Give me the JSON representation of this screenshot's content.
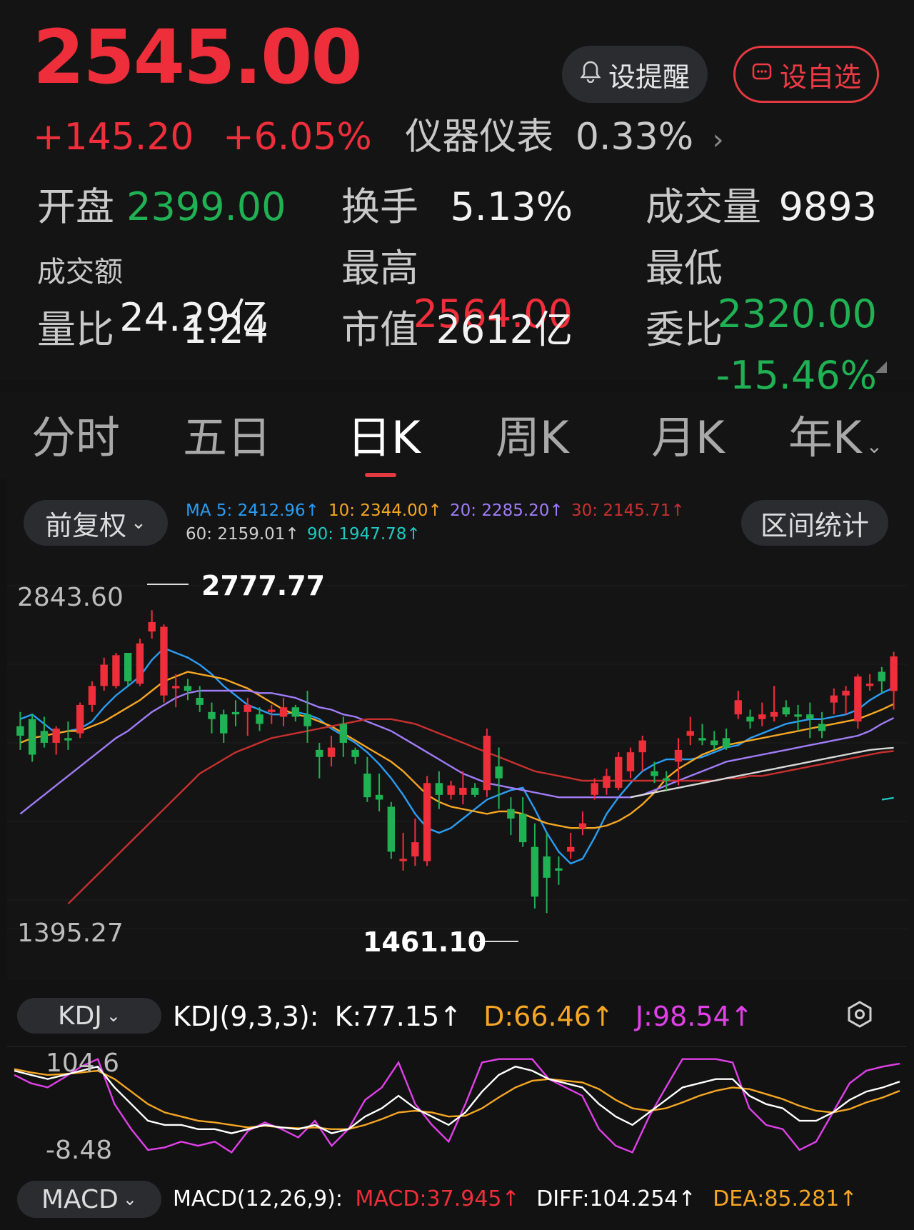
{
  "quote": {
    "price": "2545.00",
    "change": "+145.20",
    "change_pct": "+6.05%",
    "sector_name": "仪器仪表",
    "sector_pct": "0.33%"
  },
  "actions": {
    "alert_label": "设提醒",
    "watchlist_label": "设自选"
  },
  "stats": [
    {
      "label": "开盘",
      "value": "2399.00",
      "color": "green"
    },
    {
      "label": "换手",
      "value": "5.13%",
      "color": "white"
    },
    {
      "label": "成交量",
      "value": "9893",
      "color": "white"
    },
    {
      "label": "成交额",
      "value": "24.29亿",
      "color": "white"
    },
    {
      "label": "最高",
      "value": "2564.00",
      "color": "red"
    },
    {
      "label": "最低",
      "value": "2320.00",
      "color": "green"
    },
    {
      "label": "量比",
      "value": "1.24",
      "color": "white"
    },
    {
      "label": "市值",
      "value": "2612亿",
      "color": "white"
    },
    {
      "label": "委比",
      "value": "-15.46%",
      "color": "green"
    }
  ],
  "tabs": [
    {
      "label": "分时",
      "active": false
    },
    {
      "label": "五日",
      "active": false
    },
    {
      "label": "日K",
      "active": true
    },
    {
      "label": "周K",
      "active": false
    },
    {
      "label": "月K",
      "active": false
    },
    {
      "label": "年K",
      "active": false
    }
  ],
  "chart_controls": {
    "adjust_label": "前复权",
    "range_label": "区间统计"
  },
  "ma_legend": [
    {
      "text": "MA 5: 2412.96↑",
      "color": "#2a9df4"
    },
    {
      "text": "10: 2344.00↑",
      "color": "#f5a623"
    },
    {
      "text": "20: 2285.20↑",
      "color": "#a07cf7"
    },
    {
      "text": "30: 2145.71↑",
      "color": "#c8302f"
    },
    {
      "text": "60: 2159.01↑",
      "color": "#cfcfcf"
    },
    {
      "text": "90: 1947.78↑",
      "color": "#1fc9c0"
    }
  ],
  "colors": {
    "up": "#ee2e3a",
    "down": "#1fb153",
    "ma5": "#2a9df4",
    "ma10": "#f5a623",
    "ma20": "#a07cf7",
    "ma30": "#c8302f",
    "ma60": "#d8d8d8",
    "ma90": "#1fc9c0"
  },
  "chart_data": {
    "type": "candlestick",
    "y_axis_top_label": "2843.60",
    "y_axis_bottom_label": "1395.27",
    "ylim": [
      1395.27,
      2843.6
    ],
    "high_marker": "2777.77",
    "low_marker": "1461.10",
    "candles": [
      {
        "o": 2250,
        "h": 2310,
        "l": 2150,
        "c": 2210
      },
      {
        "o": 2280,
        "h": 2300,
        "l": 2100,
        "c": 2130
      },
      {
        "o": 2230,
        "h": 2290,
        "l": 2160,
        "c": 2180
      },
      {
        "o": 2180,
        "h": 2250,
        "l": 2130,
        "c": 2240
      },
      {
        "o": 2200,
        "h": 2270,
        "l": 2150,
        "c": 2190
      },
      {
        "o": 2220,
        "h": 2350,
        "l": 2200,
        "c": 2340
      },
      {
        "o": 2340,
        "h": 2440,
        "l": 2310,
        "c": 2420
      },
      {
        "o": 2420,
        "h": 2540,
        "l": 2400,
        "c": 2510
      },
      {
        "o": 2420,
        "h": 2560,
        "l": 2410,
        "c": 2550
      },
      {
        "o": 2560,
        "h": 2520,
        "l": 2420,
        "c": 2440
      },
      {
        "o": 2430,
        "h": 2620,
        "l": 2420,
        "c": 2600
      },
      {
        "o": 2650,
        "h": 2740,
        "l": 2620,
        "c": 2690
      },
      {
        "o": 2380,
        "h": 2680,
        "l": 2350,
        "c": 2670
      },
      {
        "o": 2410,
        "h": 2470,
        "l": 2330,
        "c": 2420
      },
      {
        "o": 2420,
        "h": 2450,
        "l": 2360,
        "c": 2400
      },
      {
        "o": 2370,
        "h": 2420,
        "l": 2310,
        "c": 2340
      },
      {
        "o": 2310,
        "h": 2350,
        "l": 2220,
        "c": 2280
      },
      {
        "o": 2300,
        "h": 2320,
        "l": 2180,
        "c": 2220
      },
      {
        "o": 2310,
        "h": 2360,
        "l": 2250,
        "c": 2300
      },
      {
        "o": 2310,
        "h": 2370,
        "l": 2210,
        "c": 2340
      },
      {
        "o": 2300,
        "h": 2330,
        "l": 2230,
        "c": 2260
      },
      {
        "o": 2310,
        "h": 2340,
        "l": 2260,
        "c": 2320
      },
      {
        "o": 2290,
        "h": 2370,
        "l": 2250,
        "c": 2330
      },
      {
        "o": 2330,
        "h": 2340,
        "l": 2270,
        "c": 2290
      },
      {
        "o": 2300,
        "h": 2400,
        "l": 2180,
        "c": 2250
      },
      {
        "o": 2150,
        "h": 2180,
        "l": 2030,
        "c": 2120
      },
      {
        "o": 2120,
        "h": 2210,
        "l": 2080,
        "c": 2160
      },
      {
        "o": 2260,
        "h": 2290,
        "l": 2120,
        "c": 2180
      },
      {
        "o": 2150,
        "h": 2160,
        "l": 2090,
        "c": 2120
      },
      {
        "o": 2050,
        "h": 2120,
        "l": 1930,
        "c": 1950
      },
      {
        "o": 1960,
        "h": 2050,
        "l": 1890,
        "c": 1940
      },
      {
        "o": 1910,
        "h": 1930,
        "l": 1690,
        "c": 1720
      },
      {
        "o": 1680,
        "h": 1800,
        "l": 1640,
        "c": 1690
      },
      {
        "o": 1700,
        "h": 1860,
        "l": 1660,
        "c": 1760
      },
      {
        "o": 1680,
        "h": 2040,
        "l": 1660,
        "c": 2010
      },
      {
        "o": 2010,
        "h": 2060,
        "l": 1900,
        "c": 1960
      },
      {
        "o": 1960,
        "h": 2020,
        "l": 1940,
        "c": 2000
      },
      {
        "o": 1960,
        "h": 2060,
        "l": 1920,
        "c": 1990
      },
      {
        "o": 1990,
        "h": 2010,
        "l": 1950,
        "c": 1960
      },
      {
        "o": 1980,
        "h": 2240,
        "l": 1950,
        "c": 2210
      },
      {
        "o": 2080,
        "h": 2160,
        "l": 1900,
        "c": 2030
      },
      {
        "o": 1900,
        "h": 1950,
        "l": 1790,
        "c": 1860
      },
      {
        "o": 1880,
        "h": 1950,
        "l": 1740,
        "c": 1760
      },
      {
        "o": 1740,
        "h": 1840,
        "l": 1480,
        "c": 1530
      },
      {
        "o": 1700,
        "h": 1800,
        "l": 1461,
        "c": 1610
      },
      {
        "o": 1650,
        "h": 1700,
        "l": 1580,
        "c": 1640
      },
      {
        "o": 1720,
        "h": 1800,
        "l": 1690,
        "c": 1740
      },
      {
        "o": 1820,
        "h": 1890,
        "l": 1790,
        "c": 1840
      },
      {
        "o": 1960,
        "h": 2030,
        "l": 1940,
        "c": 2010
      },
      {
        "o": 1990,
        "h": 2070,
        "l": 1960,
        "c": 2040
      },
      {
        "o": 1990,
        "h": 2140,
        "l": 1980,
        "c": 2120
      },
      {
        "o": 2060,
        "h": 2160,
        "l": 2030,
        "c": 2140
      },
      {
        "o": 2140,
        "h": 2210,
        "l": 2060,
        "c": 2190
      },
      {
        "o": 2060,
        "h": 2100,
        "l": 2010,
        "c": 2040
      },
      {
        "o": 2030,
        "h": 2060,
        "l": 1980,
        "c": 2020
      },
      {
        "o": 2100,
        "h": 2200,
        "l": 2000,
        "c": 2150
      },
      {
        "o": 2210,
        "h": 2290,
        "l": 2170,
        "c": 2230
      },
      {
        "o": 2200,
        "h": 2260,
        "l": 2170,
        "c": 2190
      },
      {
        "o": 2190,
        "h": 2230,
        "l": 2150,
        "c": 2170
      },
      {
        "o": 2200,
        "h": 2240,
        "l": 2150,
        "c": 2160
      },
      {
        "o": 2300,
        "h": 2400,
        "l": 2280,
        "c": 2360
      },
      {
        "o": 2290,
        "h": 2320,
        "l": 2240,
        "c": 2270
      },
      {
        "o": 2280,
        "h": 2350,
        "l": 2250,
        "c": 2300
      },
      {
        "o": 2290,
        "h": 2420,
        "l": 2270,
        "c": 2310
      },
      {
        "o": 2330,
        "h": 2360,
        "l": 2290,
        "c": 2300
      },
      {
        "o": 2300,
        "h": 2340,
        "l": 2230,
        "c": 2290
      },
      {
        "o": 2300,
        "h": 2350,
        "l": 2200,
        "c": 2280
      },
      {
        "o": 2260,
        "h": 2310,
        "l": 2200,
        "c": 2230
      },
      {
        "o": 2350,
        "h": 2410,
        "l": 2300,
        "c": 2380
      },
      {
        "o": 2380,
        "h": 2420,
        "l": 2300,
        "c": 2400
      },
      {
        "o": 2270,
        "h": 2470,
        "l": 2240,
        "c": 2460
      },
      {
        "o": 2420,
        "h": 2470,
        "l": 2400,
        "c": 2430
      },
      {
        "o": 2480,
        "h": 2500,
        "l": 2390,
        "c": 2440
      },
      {
        "o": 2399,
        "h": 2564,
        "l": 2320,
        "c": 2545
      }
    ],
    "ma_series": [
      {
        "key": "ma5",
        "values": [
          2280,
          2300,
          2260,
          2220,
          2230,
          2240,
          2270,
          2330,
          2380,
          2420,
          2460,
          2530,
          2580,
          2560,
          2540,
          2510,
          2470,
          2420,
          2380,
          2340,
          2320,
          2300,
          2300,
          2310,
          2300,
          2280,
          2240,
          2210,
          2180,
          2140,
          2090,
          2030,
          1960,
          1880,
          1820,
          1800,
          1820,
          1860,
          1900,
          1940,
          1960,
          1980,
          1990,
          1900,
          1800,
          1720,
          1670,
          1690,
          1780,
          1880,
          1950,
          2010,
          2060,
          2090,
          2110,
          2110,
          2110,
          2120,
          2140,
          2160,
          2170,
          2200,
          2220,
          2240,
          2260,
          2270,
          2280,
          2280,
          2290,
          2300,
          2320,
          2360,
          2390,
          2413
        ]
      },
      {
        "key": "ma10",
        "values": [
          2180,
          2200,
          2210,
          2220,
          2230,
          2230,
          2250,
          2270,
          2300,
          2330,
          2360,
          2400,
          2440,
          2460,
          2480,
          2470,
          2460,
          2450,
          2430,
          2410,
          2380,
          2350,
          2320,
          2300,
          2290,
          2270,
          2250,
          2220,
          2190,
          2160,
          2130,
          2100,
          2060,
          2010,
          1960,
          1930,
          1910,
          1900,
          1890,
          1880,
          1890,
          1890,
          1880,
          1860,
          1840,
          1830,
          1820,
          1820,
          1820,
          1830,
          1850,
          1880,
          1920,
          1970,
          2030,
          2070,
          2100,
          2130,
          2150,
          2170,
          2180,
          2190,
          2200,
          2210,
          2220,
          2230,
          2240,
          2250,
          2260,
          2270,
          2280,
          2300,
          2320,
          2344
        ]
      },
      {
        "key": "ma20",
        "values": [
          1880,
          1920,
          1960,
          2000,
          2040,
          2080,
          2120,
          2160,
          2200,
          2230,
          2270,
          2310,
          2340,
          2370,
          2390,
          2400,
          2400,
          2400,
          2400,
          2400,
          2390,
          2390,
          2380,
          2370,
          2350,
          2330,
          2320,
          2300,
          2290,
          2270,
          2250,
          2230,
          2200,
          2170,
          2140,
          2110,
          2080,
          2050,
          2030,
          2010,
          2000,
          1990,
          1980,
          1970,
          1960,
          1950,
          1950,
          1950,
          1950,
          1950,
          1950,
          1950,
          1960,
          1980,
          2000,
          2020,
          2040,
          2060,
          2080,
          2100,
          2110,
          2120,
          2130,
          2140,
          2150,
          2160,
          2170,
          2180,
          2190,
          2200,
          2210,
          2230,
          2260,
          2285
        ]
      },
      {
        "key": "ma30",
        "values": [
          1500,
          1550,
          1600,
          1650,
          1700,
          1750,
          1800,
          1850,
          1900,
          1950,
          2000,
          2050,
          2080,
          2110,
          2140,
          2160,
          2180,
          2200,
          2210,
          2220,
          2230,
          2240,
          2250,
          2260,
          2270,
          2280,
          2280,
          2280,
          2270,
          2260,
          2240,
          2220,
          2200,
          2180,
          2160,
          2140,
          2120,
          2100,
          2080,
          2060,
          2050,
          2040,
          2030,
          2020,
          2020,
          2020,
          2020,
          2020,
          2020,
          2020,
          2020,
          2020,
          2020,
          2020,
          2020,
          2030,
          2030,
          2040,
          2040,
          2050,
          2060,
          2070,
          2080,
          2090,
          2100,
          2110,
          2120,
          2130,
          2140,
          2145
        ]
      },
      {
        "key": "ma60",
        "values": [
          null,
          null,
          null,
          null,
          null,
          null,
          null,
          null,
          null,
          null,
          null,
          null,
          null,
          null,
          null,
          null,
          null,
          null,
          null,
          null,
          null,
          null,
          null,
          null,
          null,
          null,
          null,
          null,
          null,
          null,
          null,
          null,
          null,
          null,
          null,
          1950,
          1960,
          1970,
          1980,
          1990,
          2000,
          2010,
          2020,
          2030,
          2040,
          2050,
          2060,
          2070,
          2080,
          2090,
          2100,
          2110,
          2120,
          2130,
          2140,
          2150,
          2155,
          2159
        ]
      },
      {
        "key": "ma90",
        "values": [
          null,
          null,
          null,
          null,
          null,
          null,
          null,
          null,
          null,
          null,
          null,
          null,
          null,
          null,
          null,
          null,
          null,
          null,
          null,
          null,
          null,
          null,
          null,
          null,
          null,
          null,
          null,
          null,
          null,
          null,
          null,
          null,
          null,
          null,
          null,
          null,
          null,
          null,
          null,
          null,
          null,
          null,
          null,
          null,
          null,
          null,
          null,
          null,
          null,
          null,
          null,
          null,
          null,
          null,
          null,
          null,
          null,
          null,
          null,
          null,
          null,
          null,
          null,
          null,
          null,
          null,
          null,
          null,
          null,
          1940,
          1947.78
        ]
      }
    ]
  },
  "kdj": {
    "button_label": "KDJ",
    "params": "KDJ(9,3,3):",
    "k": "K:77.15↑",
    "d": "D:66.46↑",
    "j": "J:98.54↑",
    "top_label": "104.6",
    "bottom_label": "-8.48",
    "ylim": [
      -8.48,
      104.6
    ],
    "k_values": [
      90,
      85,
      80,
      85,
      90,
      95,
      70,
      50,
      30,
      25,
      25,
      20,
      20,
      15,
      20,
      25,
      22,
      20,
      25,
      15,
      20,
      35,
      45,
      60,
      45,
      35,
      25,
      40,
      65,
      85,
      95,
      90,
      80,
      75,
      70,
      50,
      35,
      25,
      40,
      55,
      70,
      75,
      80,
      80,
      60,
      50,
      45,
      30,
      30,
      40,
      55,
      65,
      70,
      77
    ],
    "d_values": [
      92,
      88,
      85,
      86,
      88,
      90,
      80,
      65,
      50,
      40,
      35,
      30,
      28,
      25,
      22,
      24,
      22,
      21,
      22,
      20,
      20,
      25,
      32,
      40,
      42,
      40,
      35,
      36,
      45,
      58,
      70,
      78,
      80,
      78,
      76,
      68,
      55,
      45,
      42,
      45,
      52,
      60,
      66,
      70,
      68,
      62,
      56,
      48,
      42,
      40,
      44,
      52,
      58,
      66
    ],
    "j_values": [
      85,
      75,
      70,
      82,
      95,
      104,
      50,
      20,
      -5,
      -2,
      5,
      0,
      5,
      -8,
      18,
      28,
      20,
      10,
      30,
      0,
      20,
      55,
      70,
      100,
      50,
      25,
      5,
      50,
      100,
      104,
      104,
      104,
      80,
      70,
      60,
      20,
      0,
      -8,
      35,
      70,
      104,
      104,
      104,
      100,
      45,
      25,
      20,
      -5,
      5,
      40,
      75,
      90,
      95,
      98.54
    ]
  },
  "macd": {
    "button_label": "MACD",
    "params": "MACD(12,26,9):",
    "macd": "MACD:37.945↑",
    "diff": "DIFF:104.254↑",
    "dea": "DEA:85.281↑"
  }
}
